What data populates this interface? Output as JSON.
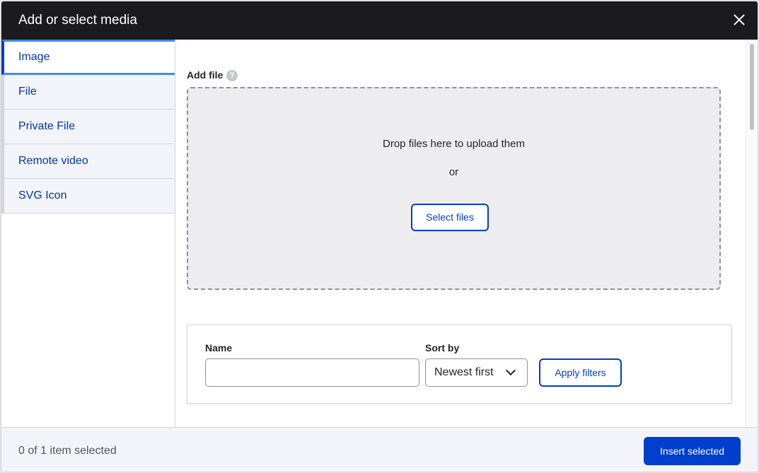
{
  "dialog": {
    "title": "Add or select media",
    "close_icon": "close-icon"
  },
  "sidebar": {
    "tabs": [
      {
        "label": "Image",
        "active": true
      },
      {
        "label": "File",
        "active": false
      },
      {
        "label": "Private File",
        "active": false
      },
      {
        "label": "Remote video",
        "active": false
      },
      {
        "label": "SVG Icon",
        "active": false
      }
    ]
  },
  "upload": {
    "label": "Add file",
    "help_icon": "?",
    "drop_text": "Drop files here to upload them",
    "or_text": "or",
    "select_button": "Select files"
  },
  "filters": {
    "name_label": "Name",
    "name_value": "",
    "sort_label": "Sort by",
    "sort_value": "Newest first",
    "apply_button": "Apply filters"
  },
  "footer": {
    "selected_count": "0 of 1 item selected",
    "insert_button": "Insert selected"
  },
  "colors": {
    "accent": "#003ecc",
    "titlebar": "#1b1b1d"
  }
}
